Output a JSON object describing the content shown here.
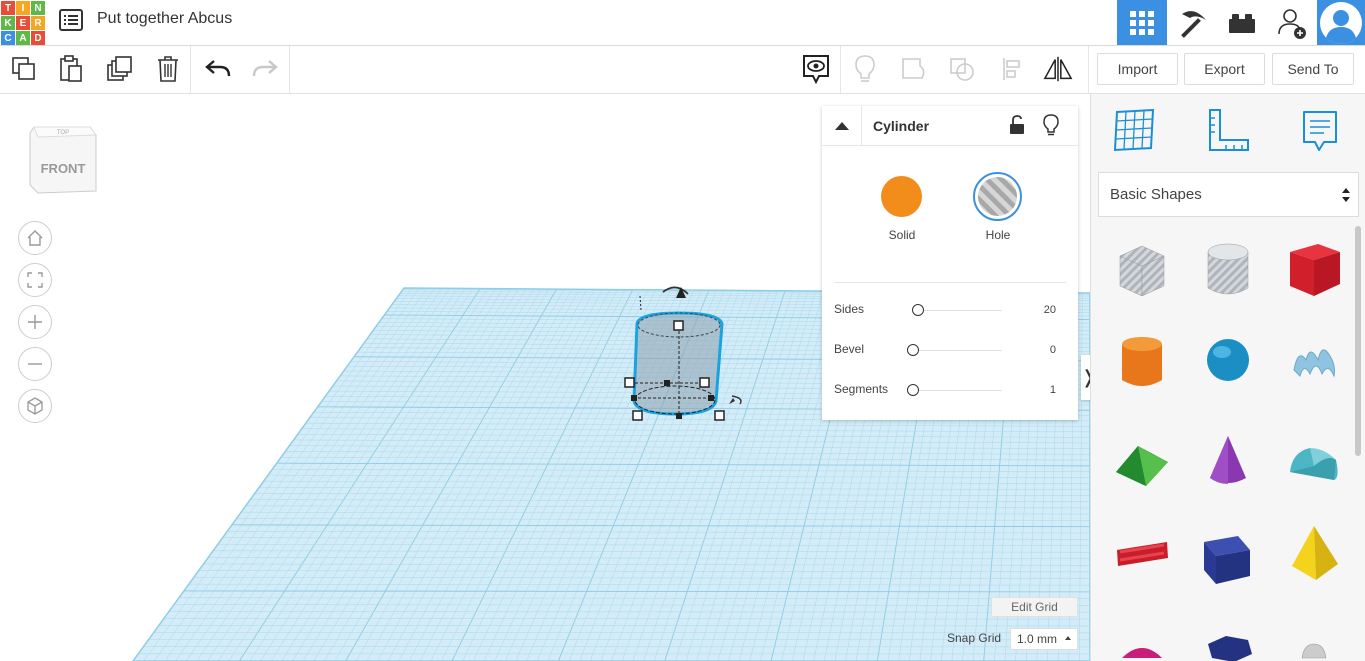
{
  "app": {
    "logo_letters": [
      "T",
      "I",
      "N",
      "K",
      "E",
      "R",
      "C",
      "A",
      "D"
    ],
    "logo_colors": [
      "#e84d38",
      "#f5a623",
      "#5fb847",
      "#5fb847",
      "#e84d38",
      "#f5a623",
      "#3c90e2",
      "#5fb847",
      "#e84d38"
    ],
    "design_title": "Put together Abcus",
    "accent_color": "#3c90e2"
  },
  "topbar": {
    "icons": [
      "grid-view-icon",
      "pickaxe-icon",
      "bricks-icon",
      "add-user-icon",
      "user-avatar-icon"
    ]
  },
  "toolbar": {
    "import_label": "Import",
    "export_label": "Export",
    "send_to_label": "Send To"
  },
  "viewcube": {
    "top_label": "TOP",
    "front_label": "FRONT"
  },
  "inspector": {
    "title": "Cylinder",
    "solid_label": "Solid",
    "hole_label": "Hole",
    "solid_color": "#f28c1b",
    "selected_mode": "Hole",
    "properties": [
      {
        "label": "Sides",
        "value": "20",
        "level": 0.06
      },
      {
        "label": "Bevel",
        "value": "0",
        "level": 0.0
      },
      {
        "label": "Segments",
        "value": "1",
        "level": 0.0
      }
    ]
  },
  "grid": {
    "edit_label": "Edit Grid",
    "snap_label": "Snap Grid",
    "snap_value": "1.0 mm"
  },
  "shapes_panel": {
    "category": "Basic Shapes",
    "shapes": [
      "box-hole",
      "cylinder-hole",
      "box",
      "cylinder",
      "sphere",
      "scribble",
      "roof",
      "cone",
      "round-roof",
      "text",
      "prism",
      "pyramid",
      "half-sphere",
      "polygon",
      "paraboloid"
    ]
  }
}
